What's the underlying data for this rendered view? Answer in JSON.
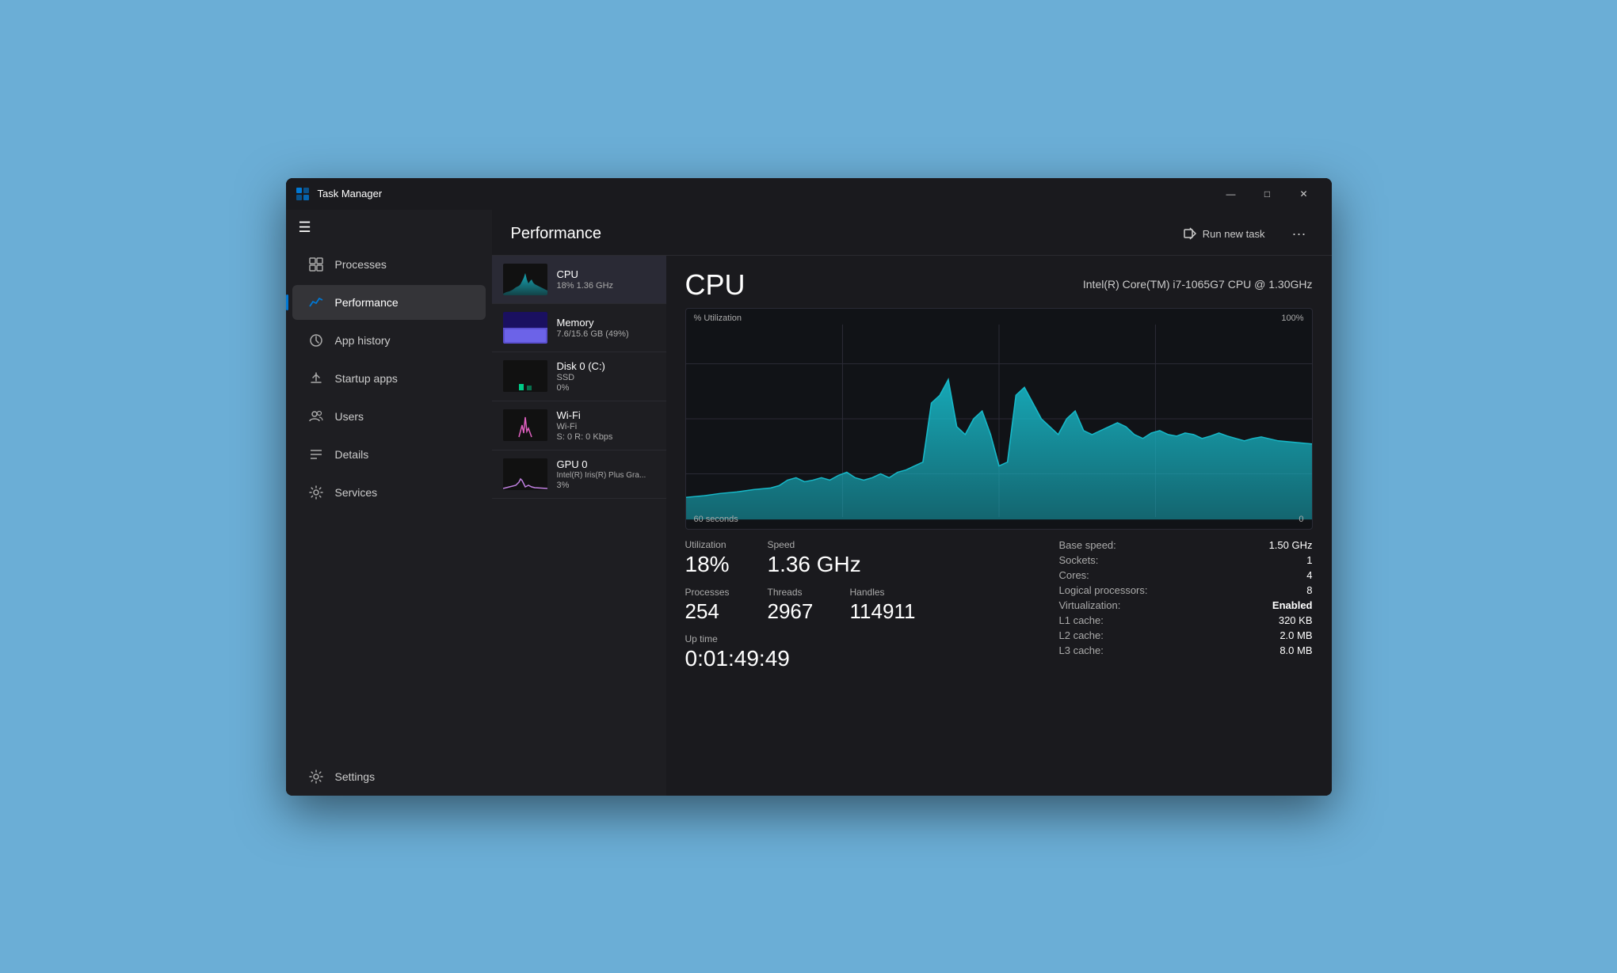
{
  "window": {
    "title": "Task Manager",
    "controls": {
      "minimize": "—",
      "maximize": "□",
      "close": "✕"
    }
  },
  "sidebar": {
    "hamburger": "☰",
    "items": [
      {
        "id": "processes",
        "label": "Processes",
        "icon": "grid"
      },
      {
        "id": "performance",
        "label": "Performance",
        "icon": "chart",
        "active": true
      },
      {
        "id": "app-history",
        "label": "App history",
        "icon": "history"
      },
      {
        "id": "startup-apps",
        "label": "Startup apps",
        "icon": "startup"
      },
      {
        "id": "users",
        "label": "Users",
        "icon": "users"
      },
      {
        "id": "details",
        "label": "Details",
        "icon": "details"
      },
      {
        "id": "services",
        "label": "Services",
        "icon": "services"
      }
    ],
    "settings": {
      "label": "Settings",
      "icon": "gear"
    }
  },
  "header": {
    "title": "Performance",
    "run_new_task": "Run new task",
    "more_icon": "···"
  },
  "devices": [
    {
      "id": "cpu",
      "name": "CPU",
      "sub1": "18%  1.36 GHz",
      "active": true,
      "type": "cpu"
    },
    {
      "id": "memory",
      "name": "Memory",
      "sub1": "7.6/15.6 GB (49%)",
      "type": "memory"
    },
    {
      "id": "disk",
      "name": "Disk 0 (C:)",
      "sub1": "SSD",
      "sub2": "0%",
      "type": "disk"
    },
    {
      "id": "wifi",
      "name": "Wi-Fi",
      "sub1": "Wi-Fi",
      "sub2": "S: 0  R: 0 Kbps",
      "type": "wifi"
    },
    {
      "id": "gpu",
      "name": "GPU 0",
      "sub1": "Intel(R) Iris(R) Plus Gra...",
      "sub2": "3%",
      "type": "gpu"
    }
  ],
  "detail": {
    "title": "CPU",
    "processor": "Intel(R) Core(TM) i7-1065G7 CPU @ 1.30GHz",
    "chart": {
      "util_label": "% Utilization",
      "max_label": "100%",
      "time_label": "60 seconds",
      "zero_label": "0"
    },
    "stats": {
      "utilization_label": "Utilization",
      "utilization_value": "18%",
      "speed_label": "Speed",
      "speed_value": "1.36 GHz",
      "processes_label": "Processes",
      "processes_value": "254",
      "threads_label": "Threads",
      "threads_value": "2967",
      "handles_label": "Handles",
      "handles_value": "114911",
      "uptime_label": "Up time",
      "uptime_value": "0:01:49:49"
    },
    "specs": {
      "base_speed_label": "Base speed:",
      "base_speed_value": "1.50 GHz",
      "sockets_label": "Sockets:",
      "sockets_value": "1",
      "cores_label": "Cores:",
      "cores_value": "4",
      "logical_label": "Logical processors:",
      "logical_value": "8",
      "virtualization_label": "Virtualization:",
      "virtualization_value": "Enabled",
      "l1_label": "L1 cache:",
      "l1_value": "320 KB",
      "l2_label": "L2 cache:",
      "l2_value": "2.0 MB",
      "l3_label": "L3 cache:",
      "l3_value": "8.0 MB"
    }
  },
  "colors": {
    "accent": "#0078d4",
    "cpu_chart": "#17b8c8",
    "memory_bar": "#6c63e8",
    "active_blue": "#0078d4"
  }
}
